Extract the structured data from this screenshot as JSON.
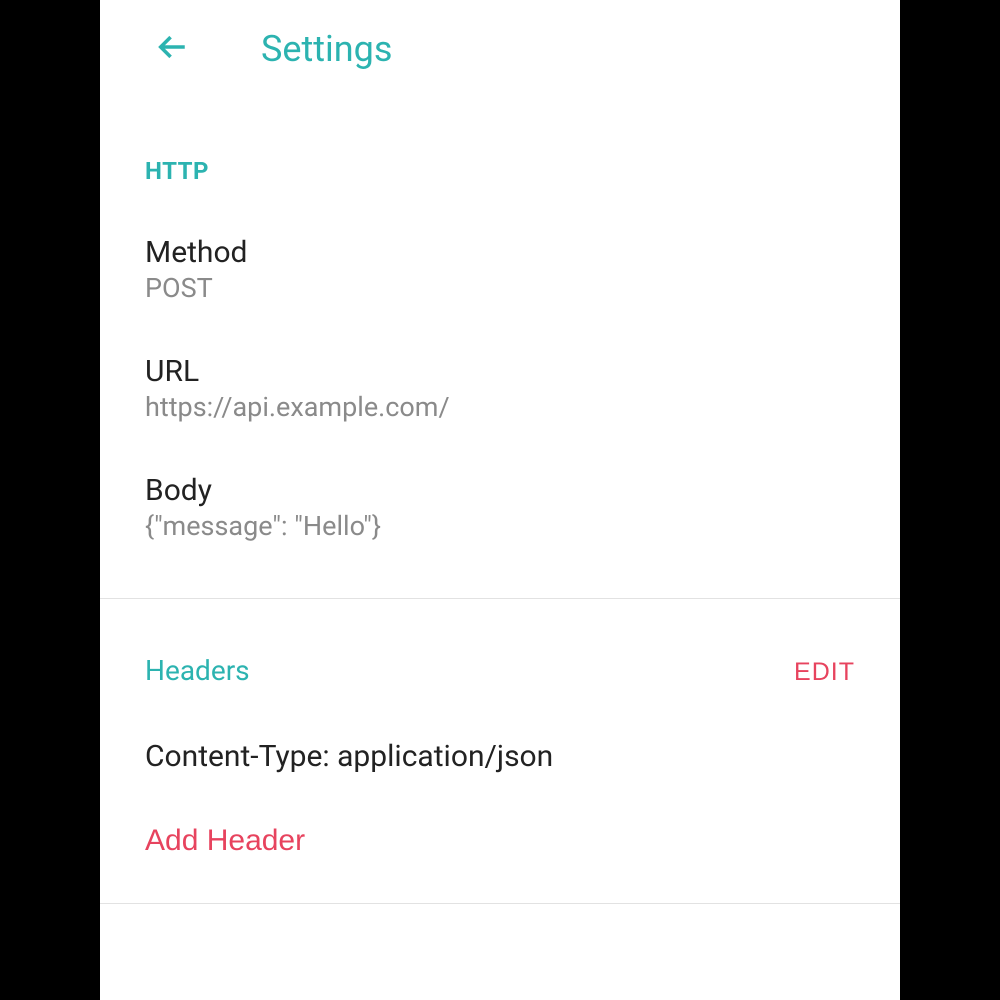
{
  "header": {
    "title": "Settings"
  },
  "http": {
    "section_label": "HTTP",
    "method_label": "Method",
    "method_value": "POST",
    "url_label": "URL",
    "url_value": "https://api.example.com/",
    "body_label": "Body",
    "body_value": "{\"message\": \"Hello\"}"
  },
  "headers": {
    "section_label": "Headers",
    "edit_label": "EDIT",
    "items": [
      "Content-Type: application/json"
    ],
    "add_label": "Add Header"
  }
}
